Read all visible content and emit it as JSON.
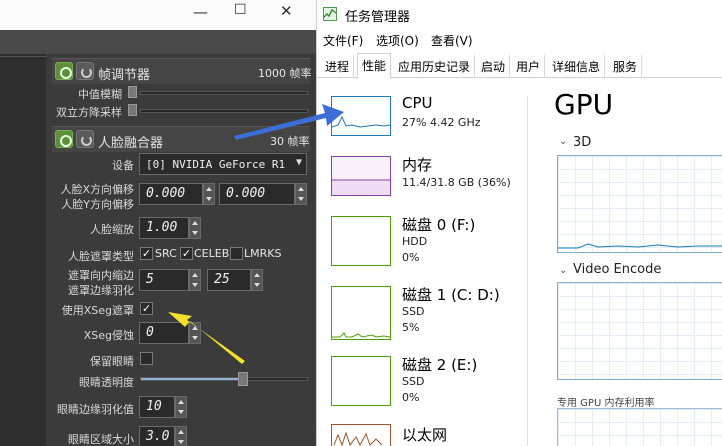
{
  "left_app": {
    "section_frame": {
      "title": "帧调节器",
      "value": "1000 帧率",
      "rows": [
        {
          "label": "中值模糊"
        },
        {
          "label": "双立方降采样"
        }
      ]
    },
    "section_face": {
      "title": "人脸融合器",
      "value": "30 帧率",
      "device_label": "设备",
      "device_value": "[0] NVIDIA GeForce R1",
      "offset_label_x": "人脸X方向偏移",
      "offset_label_y": "人脸Y方向偏移",
      "offset_x": "0.000",
      "offset_y": "0.000",
      "scale_label": "人脸缩放",
      "scale_value": "1.00",
      "mask_type_label": "人脸遮罩类型",
      "mask_opts": [
        "SRC",
        "CELEB",
        "LMRKS"
      ],
      "mask_checks": [
        "✓",
        "✓",
        ""
      ],
      "erode_label": "遮罩向内缩边",
      "blur_label": "遮罩边缘羽化",
      "erode_value": "5",
      "blur_value": "25",
      "xseg_mask_label": "使用XSeg遮罩",
      "xseg_mask_check": "✓",
      "xseg_erode_label": "XSeg侵蚀",
      "xseg_erode_value": "0",
      "keep_eyes_label": "保留眼睛",
      "eye_alpha_label": "眼睛透明度",
      "eye_alpha_level": 0.62,
      "eye_feather_label": "眼睛边缘羽化值",
      "eye_feather_value": "10",
      "eye_area_label": "眼睛区域大小",
      "eye_area_value": "3.0"
    },
    "colors": {
      "bg": "#3b3b3b",
      "power": "#5e8f3a"
    }
  },
  "right_app": {
    "title": "任务管理器",
    "menu": [
      "文件(F)",
      "选项(O)",
      "查看(V)"
    ],
    "tabs": [
      "进程",
      "性能",
      "应用历史记录",
      "启动",
      "用户",
      "详细信息",
      "服务"
    ],
    "active_tab": "性能",
    "resources": [
      {
        "name": "CPU",
        "sub1": "27% 4.42 GHz",
        "sub2": ""
      },
      {
        "name": "内存",
        "sub1": "11.4/31.8 GB (36%)",
        "sub2": ""
      },
      {
        "name": "磁盘 0 (F:)",
        "sub1": "HDD",
        "sub2": "0%"
      },
      {
        "name": "磁盘 1 (C: D:)",
        "sub1": "SSD",
        "sub2": "5%"
      },
      {
        "name": "磁盘 2 (E:)",
        "sub1": "SSD",
        "sub2": "0%"
      },
      {
        "name": "以太网",
        "sub1": "",
        "sub2": ""
      }
    ],
    "gpu": {
      "heading": "GPU",
      "graphs": [
        "3D",
        "Video Encode"
      ],
      "mem_label": "专用 GPU 内存利用率"
    },
    "colors": {
      "cpu": "#1a7bb9",
      "memory": "#8b3ea6",
      "disk": "#4da000",
      "ethernet": "#a7522b"
    }
  }
}
